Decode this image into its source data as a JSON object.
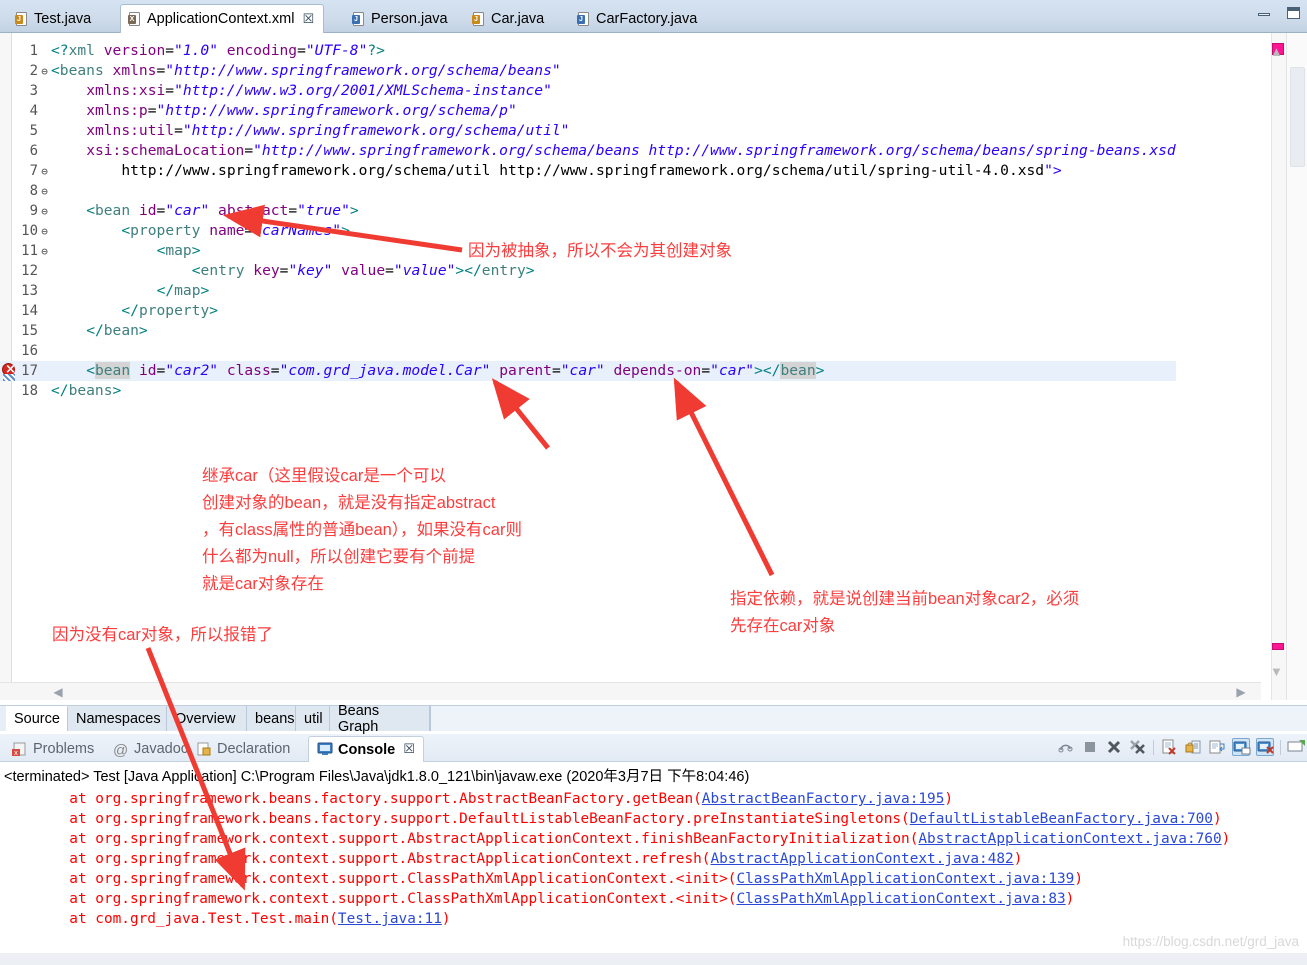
{
  "window": {
    "minimize_label": "minimize",
    "maximize_label": "maximize"
  },
  "editor_tabs": [
    {
      "label": "Test.java",
      "icon": "java-file-icon",
      "badge": "J",
      "active": false,
      "closable": false
    },
    {
      "label": "ApplicationContext.xml",
      "icon": "xml-file-icon",
      "badge": "X",
      "active": true,
      "closable": true,
      "close_glyph": "☒"
    },
    {
      "label": "Person.java",
      "icon": "java-file-icon",
      "badge": "J",
      "active": false,
      "closable": false
    },
    {
      "label": "Car.java",
      "icon": "java-file-icon",
      "badge": "J",
      "active": false,
      "closable": false
    },
    {
      "label": "CarFactory.java",
      "icon": "java-file-icon",
      "badge": "J",
      "active": false,
      "closable": false
    }
  ],
  "code": {
    "lines": [
      {
        "num": "1",
        "fold": "",
        "text": "<?xml version=\"1.0\" encoding=\"UTF-8\"?>"
      },
      {
        "num": "2",
        "fold": "⊖",
        "text": "<beans xmlns=\"http://www.springframework.org/schema/beans\""
      },
      {
        "num": "3",
        "fold": "",
        "text": "    xmlns:xsi=\"http://www.w3.org/2001/XMLSchema-instance\""
      },
      {
        "num": "4",
        "fold": "",
        "text": "    xmlns:p=\"http://www.springframework.org/schema/p\""
      },
      {
        "num": "5",
        "fold": "",
        "text": "    xmlns:util=\"http://www.springframework.org/schema/util\""
      },
      {
        "num": "6",
        "fold": "",
        "text": "    xsi:schemaLocation=\"http://www.springframework.org/schema/beans http://www.springframework.org/schema/beans/spring-beans.xsd"
      },
      {
        "num": "7",
        "fold": "⊖",
        "text": "        http://www.springframework.org/schema/util http://www.springframework.org/schema/util/spring-util-4.0.xsd\">"
      },
      {
        "num": "8",
        "fold": "⊖",
        "text": ""
      },
      {
        "num": "9",
        "fold": "⊖",
        "text": "    <bean id=\"car\" abstract=\"true\">"
      },
      {
        "num": "10",
        "fold": "⊖",
        "text": "        <property name=\"carNames\">"
      },
      {
        "num": "11",
        "fold": "⊖",
        "text": "            <map>"
      },
      {
        "num": "12",
        "fold": "",
        "text": "                <entry key=\"key\" value=\"value\"></entry>"
      },
      {
        "num": "13",
        "fold": "",
        "text": "            </map>"
      },
      {
        "num": "14",
        "fold": "",
        "text": "        </property>"
      },
      {
        "num": "15",
        "fold": "",
        "text": "    </bean>"
      },
      {
        "num": "16",
        "fold": "",
        "text": ""
      },
      {
        "num": "17",
        "fold": "",
        "text": "    <bean id=\"car2\" class=\"com.grd_java.model.Car\" parent=\"car\" depends-on=\"car\"></bean>",
        "error": true,
        "highlight": true
      },
      {
        "num": "18",
        "fold": "",
        "text": "</beans>"
      }
    ]
  },
  "source_tabs": [
    {
      "label": "Source",
      "active": true
    },
    {
      "label": "Namespaces",
      "active": false
    },
    {
      "label": "Overview",
      "active": false
    },
    {
      "label": "beans",
      "active": false
    },
    {
      "label": "util",
      "active": false
    },
    {
      "label": "Beans Graph",
      "active": false
    }
  ],
  "view_tabs": [
    {
      "label": "Problems",
      "icon": "problems-icon",
      "active": false
    },
    {
      "label": "Javadoc",
      "icon": "javadoc-icon",
      "active": false
    },
    {
      "label": "Declaration",
      "icon": "declaration-icon",
      "active": false
    },
    {
      "label": "Console",
      "icon": "console-icon",
      "active": true,
      "close_glyph": "☒"
    }
  ],
  "console_toolbar": [
    {
      "name": "terminate-all-icon"
    },
    {
      "name": "terminate-icon"
    },
    {
      "name": "remove-launch-icon"
    },
    {
      "name": "remove-all-terminated-icon"
    },
    {
      "name": "clear-console-icon"
    },
    {
      "name": "scroll-lock-icon"
    },
    {
      "name": "word-wrap-icon"
    },
    {
      "name": "display-selected-console-icon",
      "selected": true
    },
    {
      "name": "open-console-icon",
      "selected": true
    },
    {
      "name": "pin-console-icon"
    }
  ],
  "console": {
    "terminated_line": "<terminated> Test [Java Application] C:\\Program Files\\Java\\jdk1.8.0_121\\bin\\javaw.exe (2020年3月7日 下午8:04:46)",
    "trace": [
      {
        "prefix": "        at org.springframework.beans.factory.support.AbstractBeanFactory.getBean(",
        "link": "AbstractBeanFactory.java:195",
        "suffix": ")"
      },
      {
        "prefix": "        at org.springframework.beans.factory.support.DefaultListableBeanFactory.preInstantiateSingletons(",
        "link": "DefaultListableBeanFactory.java:700",
        "suffix": ")"
      },
      {
        "prefix": "        at org.springframework.context.support.AbstractApplicationContext.finishBeanFactoryInitialization(",
        "link": "AbstractApplicationContext.java:760",
        "suffix": ")"
      },
      {
        "prefix": "        at org.springframework.context.support.AbstractApplicationContext.refresh(",
        "link": "AbstractApplicationContext.java:482",
        "suffix": ")"
      },
      {
        "prefix": "        at org.springframework.context.support.ClassPathXmlApplicationContext.<init>(",
        "link": "ClassPathXmlApplicationContext.java:139",
        "suffix": ")"
      },
      {
        "prefix": "        at org.springframework.context.support.ClassPathXmlApplicationContext.<init>(",
        "link": "ClassPathXmlApplicationContext.java:83",
        "suffix": ")"
      },
      {
        "prefix": "        at com.grd_java.Test.Test.main(",
        "link": "Test.java:11",
        "suffix": ")"
      }
    ]
  },
  "annotations": [
    {
      "name": "annotation-abstract",
      "text": "因为被抽象，所以不会为其创建对象"
    },
    {
      "name": "annotation-parent",
      "text": "继承car（这里假设car是一个可以\n创建对象的bean，就是没有指定abstract\n，有class属性的普通bean），如果没有car则\n什么都为null，所以创建它要有个前提\n就是car对象存在"
    },
    {
      "name": "annotation-depends-on",
      "text": "指定依赖，就是说创建当前bean对象car2，必须\n先存在car对象"
    },
    {
      "name": "annotation-error-reason",
      "text": "因为没有car对象，所以报错了"
    }
  ],
  "watermark": "https://blog.csdn.net/grd_java",
  "colors": {
    "annotation_red": "#fc3d3d",
    "console_error": "#ff0000",
    "console_link": "#2a49d6",
    "string_blue": "#2a00ff",
    "tag_teal": "#3f7f7f",
    "attr_purple": "#7f007f",
    "marker_pink": "#ff1493"
  }
}
